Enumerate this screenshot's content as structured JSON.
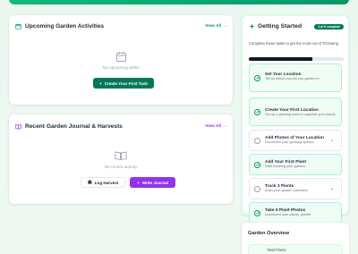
{
  "colors": {
    "accent": "#047857",
    "purple": "#9333ea",
    "bg": "#eaf7ef"
  },
  "upcoming": {
    "title": "Upcoming Garden Activities",
    "view_all": "View All",
    "empty_text": "No upcoming tasks",
    "cta": "Create Your First Task"
  },
  "journal": {
    "title": "Recent Garden Journal & Harvests",
    "view_all": "View All",
    "empty_text": "No recent activity",
    "log_harvest": "Log Harvest",
    "write_journal": "Write Journal"
  },
  "getting_started": {
    "title": "Getting Started",
    "badge": "4 of 6 complete",
    "description": "Complete these tasks to get the most out of TGrowing",
    "progress": 0.67,
    "tasks": [
      {
        "title": "Set Your Location",
        "subtitle": "Tell us which country you garden in",
        "done": true
      },
      {
        "title": "Create Your First Location",
        "subtitle": "Set up a growing area to organize your plants",
        "done": true
      },
      {
        "title": "Add Photos of Your Location",
        "subtitle": "Document your growing spaces",
        "done": false
      },
      {
        "title": "Add Your First Plant",
        "subtitle": "Start tracking your garden",
        "done": true
      },
      {
        "title": "Track 3 Plants",
        "subtitle": "Build your garden collection",
        "done": false
      },
      {
        "title": "Take 5 Plant Photos",
        "subtitle": "Document your plants' growth",
        "done": true
      }
    ]
  },
  "overview": {
    "title": "Garden Overview",
    "total_plants_label": "Total Plants"
  }
}
